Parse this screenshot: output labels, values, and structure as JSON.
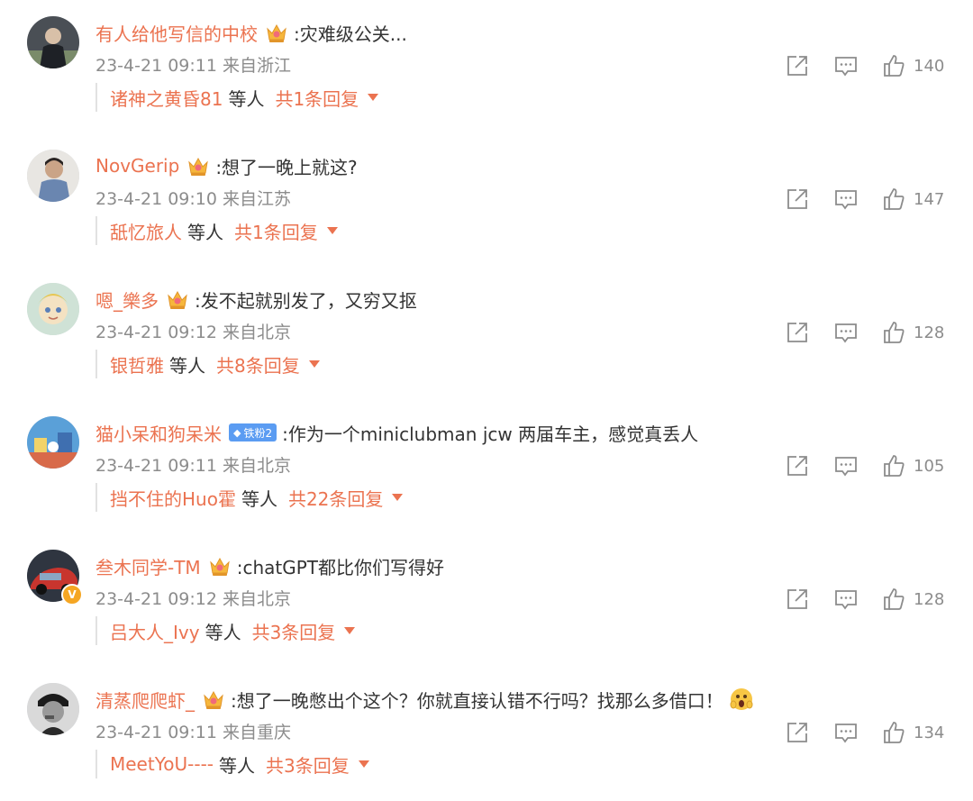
{
  "colors": {
    "accent": "#eb7350",
    "text": "#333333",
    "meta": "#8c8c8c",
    "fan_badge": "#5b9cf2"
  },
  "comments": [
    {
      "username": "有人给他写信的中校",
      "badge_icon": "crown-icon",
      "text": ":灾难级公关...",
      "time": "23-4-21 09:11",
      "location": "来自浙江",
      "likes": "140",
      "replier": "诸神之黄昏81",
      "deng": "等人",
      "reply_total": "共1条回复"
    },
    {
      "username": "NovGerip",
      "badge_icon": "crown-icon",
      "text": ":想了一晚上就这?",
      "time": "23-4-21 09:10",
      "location": "来自江苏",
      "likes": "147",
      "replier": "舐忆旅人",
      "deng": "等人",
      "reply_total": "共1条回复"
    },
    {
      "username": "嗯_樂多",
      "badge_icon": "crown-icon",
      "text": ":发不起就别发了，又穷又抠",
      "time": "23-4-21 09:12",
      "location": "来自北京",
      "likes": "128",
      "replier": "银哲雅",
      "deng": "等人",
      "reply_total": "共8条回复"
    },
    {
      "username": "猫小呆和狗呆米",
      "badge_icon": "diamond-icon",
      "fan_badge": "铁粉2",
      "text": ":作为一个miniclubman jcw 两届车主，感觉真丢人",
      "time": "23-4-21 09:11",
      "location": "来自北京",
      "likes": "105",
      "replier": "挡不住的Huo霍",
      "deng": "等人",
      "reply_total": "共22条回复"
    },
    {
      "username": "叁木同学-TM",
      "badge_icon": "crown-icon",
      "verified_icon": "verified-badge-icon",
      "text": ":chatGPT都比你们写得好",
      "time": "23-4-21 09:12",
      "location": "来自北京",
      "likes": "128",
      "replier": "吕大人_Ivy",
      "deng": "等人",
      "reply_total": "共3条回复"
    },
    {
      "username": "清蒸爬爬虾_",
      "badge_icon": "crown-icon",
      "text": ":想了一晚憋出个这个？你就直接认错不行吗？找那么多借口！",
      "emoji_icon": "shocked-emoji-icon",
      "time": "23-4-21 09:11",
      "location": "来自重庆",
      "likes": "134",
      "replier": "MeetYoU----",
      "deng": "等人",
      "reply_total": "共3条回复"
    }
  ]
}
